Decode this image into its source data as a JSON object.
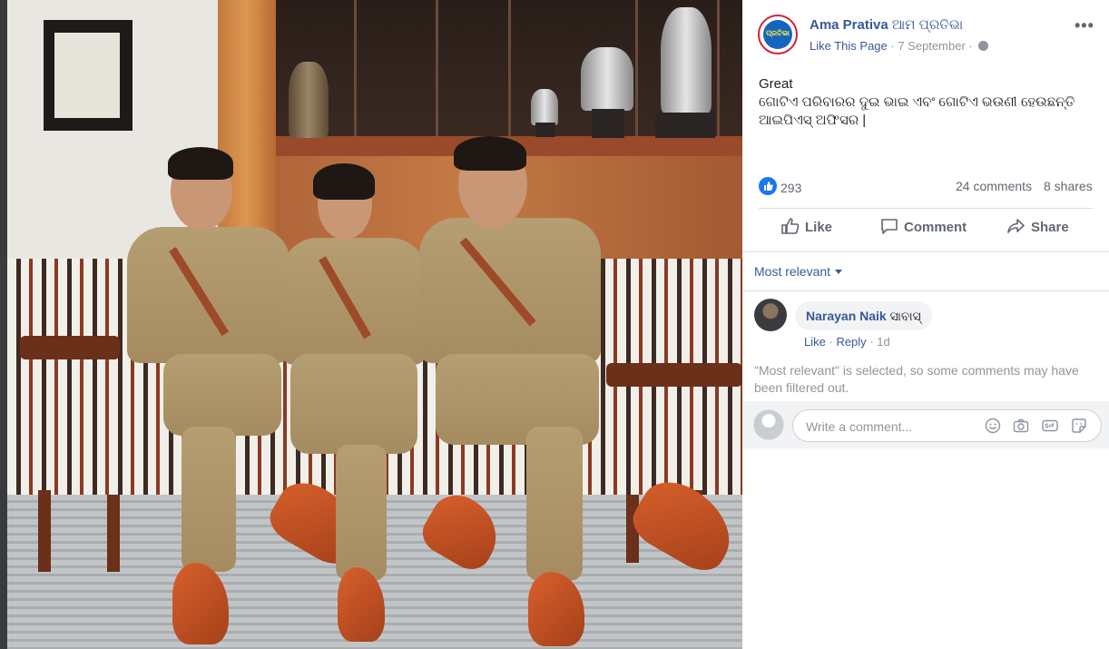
{
  "post": {
    "page_name": "Ama Prativa",
    "page_name_alt": "ଆମ ପ୍ରତିଭା",
    "avatar_text": "ପ୍ରତିଭା",
    "like_this_page": "Like This Page",
    "separator": "·",
    "date": "7 September",
    "more_label": "•••",
    "text_line1": "Great",
    "text_line2": "ଗୋଟିଏ ପରିବାରର ଦୁଇ ଭାଇ ଏବଂ ଗୋଟିଏ ଭଉଣୀ ହେଉଛନ୍ତି",
    "text_line3": "ଆଇପିଏସ୍ ଅଫିସର |"
  },
  "stats": {
    "likes": "293",
    "comments": "24 comments",
    "shares": "8 shares"
  },
  "actions": {
    "like": "Like",
    "comment": "Comment",
    "share": "Share"
  },
  "comments_section": {
    "sort_label": "Most relevant",
    "comment": {
      "author": "Narayan Naik",
      "text": "ସାବାସ୍",
      "like": "Like",
      "reply": "Reply",
      "time": "1d"
    },
    "filter_note": "\"Most relevant\" is selected, so some comments may have been filtered out.",
    "composer_placeholder": "Write a comment..."
  },
  "colors": {
    "link": "#385898",
    "muted": "#90949c",
    "like_blue": "#1877f2"
  }
}
